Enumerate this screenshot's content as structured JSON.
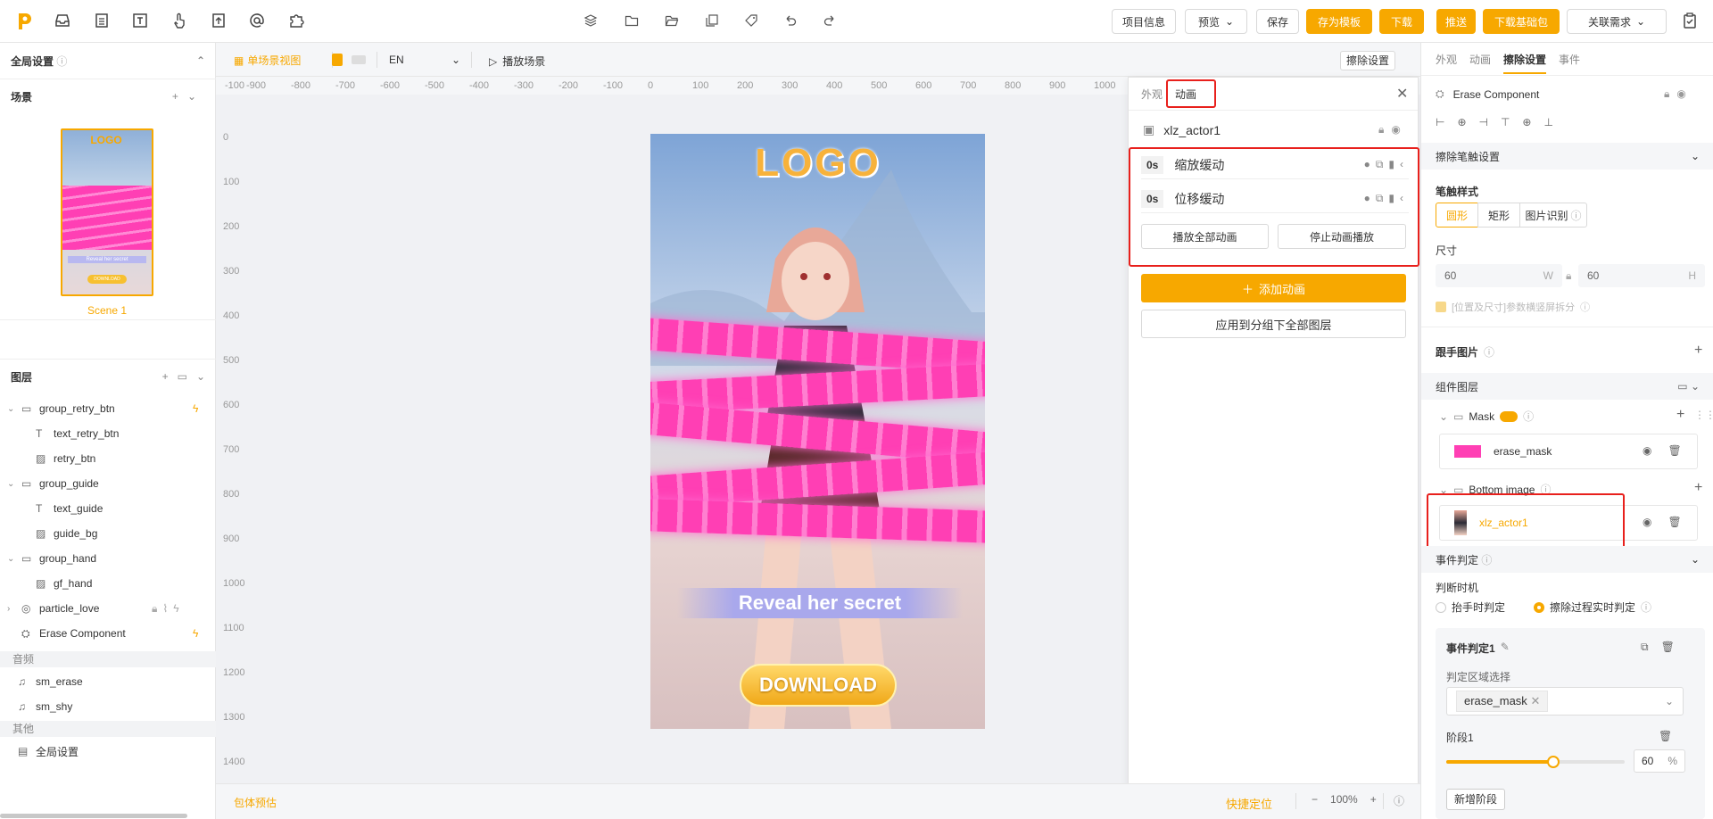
{
  "colors": {
    "accent": "#f7a800",
    "pink": "#ff3fb4",
    "highlight": "#e8201c"
  },
  "toolbar": {
    "left_icons": [
      "logo-icon",
      "inbox-icon",
      "document-icon",
      "text-icon",
      "hand-pointer-icon",
      "upload-icon",
      "at-icon",
      "plugin-icon"
    ],
    "center_icons": [
      "layers-icon",
      "folder-icon",
      "folder-open-icon",
      "copy-icon",
      "tag-icon",
      "undo-icon",
      "redo-icon"
    ],
    "project_info": "项目信息",
    "preview": "预览",
    "save": "保存",
    "save_template": "存为模板",
    "download": "下载",
    "push": "推送",
    "download_base": "下载基础包",
    "related_demand": "关联需求"
  },
  "left": {
    "global_settings": "全局设置",
    "scene_title": "场景",
    "scene_name": "Scene 1",
    "scene_thumb_banner": "Reveal her secret",
    "scene_thumb_btn": "DOWNLOAD",
    "layers_title": "图层",
    "layers": [
      {
        "name": "group_retry_btn",
        "indent": 0,
        "type": "folder",
        "flash": true
      },
      {
        "name": "text_retry_btn",
        "indent": 1,
        "type": "text"
      },
      {
        "name": "retry_btn",
        "indent": 1,
        "type": "image"
      },
      {
        "name": "group_guide",
        "indent": 0,
        "type": "folder"
      },
      {
        "name": "text_guide",
        "indent": 1,
        "type": "text"
      },
      {
        "name": "guide_bg",
        "indent": 1,
        "type": "image"
      },
      {
        "name": "group_hand",
        "indent": 0,
        "type": "folder"
      },
      {
        "name": "gf_hand",
        "indent": 1,
        "type": "image"
      },
      {
        "name": "particle_love",
        "indent": 0,
        "type": "particle"
      },
      {
        "name": "Erase Component",
        "indent": 0,
        "type": "component",
        "flash": true
      }
    ],
    "audio_title": "音频",
    "audio": [
      "sm_erase",
      "sm_shy"
    ],
    "other_title": "其他",
    "other": [
      "全局设置"
    ]
  },
  "canvas": {
    "view_mode": "单场景视图",
    "lang": "EN",
    "play_scene": "播放场景",
    "erase_settings": "擦除设置",
    "hruler": [
      "-100",
      "-900",
      "-800",
      "-700",
      "-600",
      "-500",
      "-400",
      "-300",
      "-200",
      "-100",
      "0",
      "100",
      "200",
      "300",
      "400",
      "500",
      "600",
      "700",
      "800",
      "900",
      "1000"
    ],
    "vruler": [
      "0",
      "100",
      "200",
      "300",
      "400",
      "500",
      "600",
      "700",
      "800",
      "900",
      "1000",
      "1100",
      "1200",
      "1300",
      "1400"
    ],
    "logo_text": "LOGO",
    "banner_text": "Reveal her secret",
    "download_text": "DOWNLOAD",
    "bottom_left": "包体预估",
    "quick_locate": "快捷定位",
    "zoom": "100%"
  },
  "anim_panel": {
    "tab_appearance": "外观",
    "tab_animation": "动画",
    "actor_name": "xlz_actor1",
    "items": [
      {
        "time": "0s",
        "name": "缩放缓动"
      },
      {
        "time": "0s",
        "name": "位移缓动"
      }
    ],
    "play_all": "播放全部动画",
    "stop_play": "停止动画播放",
    "add_anim": "添加动画",
    "apply_group": "应用到分组下全部图层"
  },
  "right": {
    "tabs": [
      "外观",
      "动画",
      "擦除设置",
      "事件"
    ],
    "active_tab": "擦除设置",
    "component_name": "Erase Component",
    "brush_settings": "擦除笔触设置",
    "brush_style": "笔触样式",
    "shapes": [
      "圆形",
      "矩形",
      "图片识别"
    ],
    "size_label": "尺寸",
    "width": "60",
    "width_unit": "W",
    "height": "60",
    "height_unit": "H",
    "checkbox_text": "[位置及尺寸]参数横竖屏拆分",
    "hand_image": "跟手图片",
    "component_layers": "组件图层",
    "mask_label": "Mask",
    "mask_item": "erase_mask",
    "bottom_label": "Bottom image",
    "bottom_item": "xlz_actor1",
    "event_judge": "事件判定",
    "judge_time": "判断时机",
    "radio1": "抬手时判定",
    "radio2": "擦除过程实时判定",
    "event1": "事件判定1",
    "area_select": "判定区域选择",
    "area_tag": "erase_mask",
    "stage": "阶段1",
    "stage_value": "60",
    "stage_unit": "%",
    "stage_progress": 0.6,
    "add_stage": "新增阶段"
  }
}
